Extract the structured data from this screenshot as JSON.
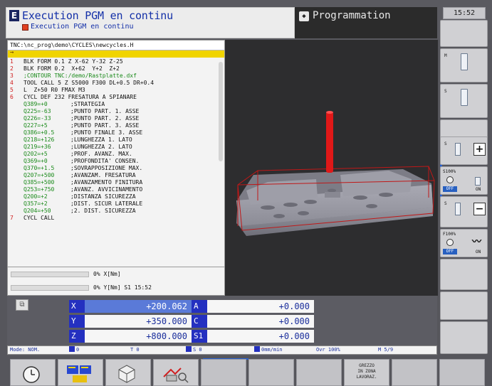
{
  "header": {
    "mode_title": "Execution PGM en continu",
    "mode_subtitle": "Execution PGM en continu",
    "secondary_mode": "Programmation",
    "clock": "15:52"
  },
  "program": {
    "path": "TNC:\\nc_prog\\demo\\CYCLES\\newcycles.H",
    "cursor_marker": "→",
    "lines": [
      {
        "n": "1",
        "code": "BLK FORM 0.1 Z X-62 Y-32 Z-25",
        "comment": "",
        "green": false
      },
      {
        "n": "2",
        "code": "BLK FORM 0.2  X+62  Y+2  Z+2",
        "comment": "",
        "green": false
      },
      {
        "n": "3",
        "code": ";CONTOUR TNC:/demo/Rastplatte.dxf",
        "comment": "",
        "green": true
      },
      {
        "n": "4",
        "code": "TOOL CALL 5 Z S5000 F300 DL+0.5 DR+0.4",
        "comment": "",
        "green": false
      },
      {
        "n": "5",
        "code": "L  Z+50 R0 FMAX M3",
        "comment": "",
        "green": false
      },
      {
        "n": "6",
        "code": "CYCL DEF 232 FRESATURA A SPIANARE",
        "comment": "",
        "green": false
      },
      {
        "n": "",
        "code": "Q389=+0",
        "comment": ";STRATEGIA",
        "green": true
      },
      {
        "n": "",
        "code": "Q225=-63",
        "comment": ";PUNTO PART. 1. ASSE",
        "green": true
      },
      {
        "n": "",
        "code": "Q226=-33",
        "comment": ";PUNTO PART. 2. ASSE",
        "green": true
      },
      {
        "n": "",
        "code": "Q227=+5",
        "comment": ";PUNTO PART. 3. ASSE",
        "green": true
      },
      {
        "n": "",
        "code": "Q386=+0.5",
        "comment": ";PUNTO FINALE 3. ASSE",
        "green": true
      },
      {
        "n": "",
        "code": "Q218=+126",
        "comment": ";LUNGHEZZA 1. LATO",
        "green": true
      },
      {
        "n": "",
        "code": "Q219=+36",
        "comment": ";LUNGHEZZA 2. LATO",
        "green": true
      },
      {
        "n": "",
        "code": "Q202=+5",
        "comment": ";PROF. AVANZ. MAX.",
        "green": true
      },
      {
        "n": "",
        "code": "Q369=+0",
        "comment": ";PROFONDITA' CONSEN.",
        "green": true
      },
      {
        "n": "",
        "code": "Q370=+1.5",
        "comment": ";SOVRAPPOSIZIONE MAX.",
        "green": true
      },
      {
        "n": "",
        "code": "Q207=+500",
        "comment": ";AVANZAM. FRESATURA",
        "green": true
      },
      {
        "n": "",
        "code": "Q385=+500",
        "comment": ";AVANZAMENTO FINITURA",
        "green": true
      },
      {
        "n": "",
        "code": "Q253=+750",
        "comment": ";AVANZ. AVVICINAMENTO",
        "green": true
      },
      {
        "n": "",
        "code": "Q200=+2",
        "comment": ";DISTANZA SICUREZZA",
        "green": true
      },
      {
        "n": "",
        "code": "Q357=+2",
        "comment": ";DIST. SICUR LATERALE",
        "green": true
      },
      {
        "n": "",
        "code": "Q204=+50",
        "comment": ";2. DIST. SICUREZZA",
        "green": true
      },
      {
        "n": "7",
        "code": "CYCL CALL",
        "comment": "",
        "green": false
      }
    ],
    "status_x": "0% X[Nm]",
    "status_y": "0% Y[Nm] S1  15:52"
  },
  "positions": {
    "corner_icon": "⧉",
    "rows": [
      {
        "axis": "X",
        "value": "+200.062",
        "axis2": "A",
        "value2": "+0.000"
      },
      {
        "axis": "Y",
        "value": "+350.000",
        "axis2": "C",
        "value2": "+0.000"
      },
      {
        "axis": "Z",
        "value": "+800.000",
        "axis2": "S1",
        "value2": "+0.000"
      }
    ]
  },
  "status_bar": {
    "mode": "Mode: NOM.",
    "t1": "0",
    "t2": "T 0",
    "s": "S 0",
    "feed": "0mm/min",
    "ovr": "Ovr 100%",
    "m": "M 5/9"
  },
  "side_keys": {
    "k1": "M",
    "k2": "S",
    "k3_tag": "S",
    "k3_sign": "+",
    "k4_ovr": "S100%",
    "k4_off": "OFF",
    "k4_on": "ON",
    "k5_tag": "S",
    "k5_sign": "−",
    "k6_ovr": "F100%",
    "k6_off": "OFF",
    "k6_on": "ON"
  },
  "bottom_keys": {
    "grezzo": "GREZZO\nIN ZONA\nLAVORAZ."
  },
  "colors": {
    "accent_blue": "#2430c0",
    "highlight_blue": "#5a7ad8",
    "cursor_yellow": "#f0d400",
    "tool_red": "#e01818"
  }
}
